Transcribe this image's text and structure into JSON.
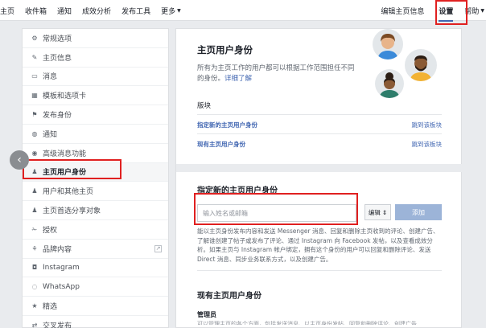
{
  "topbar": {
    "tabs": [
      "主页",
      "收件箱",
      "通知",
      "成效分析",
      "发布工具"
    ],
    "more_label": "更多",
    "edit_page_info": "编辑主页信息",
    "settings": "设置",
    "help": "帮助"
  },
  "sidebar": {
    "items": [
      {
        "label": "常规选项",
        "icon": "gear-icon"
      },
      {
        "label": "主页信息",
        "icon": "pencil-icon"
      },
      {
        "label": "消息",
        "icon": "message-icon"
      },
      {
        "label": "模板和选项卡",
        "icon": "grid-icon"
      },
      {
        "label": "发布身份",
        "icon": "flag-icon"
      },
      {
        "label": "通知",
        "icon": "globe-icon"
      },
      {
        "label": "高级消息功能",
        "icon": "chat-icon"
      },
      {
        "label": "主页用户身份",
        "icon": "person-icon"
      },
      {
        "label": "用户和其他主页",
        "icon": "people-icon"
      },
      {
        "label": "主页首选分享对象",
        "icon": "people-icon"
      },
      {
        "label": "授权",
        "icon": "wrench-icon"
      },
      {
        "label": "品牌内容",
        "icon": "handshake-icon"
      },
      {
        "label": "Instagram",
        "icon": "instagram-icon"
      },
      {
        "label": "WhatsApp",
        "icon": "whatsapp-icon"
      },
      {
        "label": "精选",
        "icon": "star-icon"
      },
      {
        "label": "交叉发布",
        "icon": "repost-icon"
      }
    ],
    "active_index": 7
  },
  "main": {
    "title": "主页用户身份",
    "intro_text": "所有为主页工作的用户都可以根据工作范围担任不同的身份。",
    "intro_link": "详细了解",
    "section_label": "版块",
    "rows": [
      {
        "label": "指定新的主页用户身份",
        "action": "跳到该板块"
      },
      {
        "label": "现有主页用户身份",
        "action": "跳到该板块"
      }
    ],
    "assign_title": "指定新的主页用户身份",
    "input_placeholder": "输入姓名或邮箱",
    "role_select": "编辑",
    "add_button": "添加",
    "description": "能以主页身份发布内容和发送 Messenger 消息、回复和删除主页收到的评论、创建广告、了解谁创建了帖子或发布了评论、通过 Instagram 向 Facebook 发帖，以及查看成效分析。如果主页与 Instagram 帐户绑定，拥有这个身份的用户可以回复和删除评论、发送 Direct 消息、同步业务联系方式，以及创建广告。",
    "existing_title": "现有主页用户身份",
    "admin_label": "管理员",
    "cut_text": "可以管理主页的各个方面，包括发送消息、以主页身份发帖、回复和删除评论、创建广告"
  },
  "colors": {
    "accent": "#4267b2",
    "highlight": "#e02020",
    "add_button": "#9cb4d8"
  }
}
